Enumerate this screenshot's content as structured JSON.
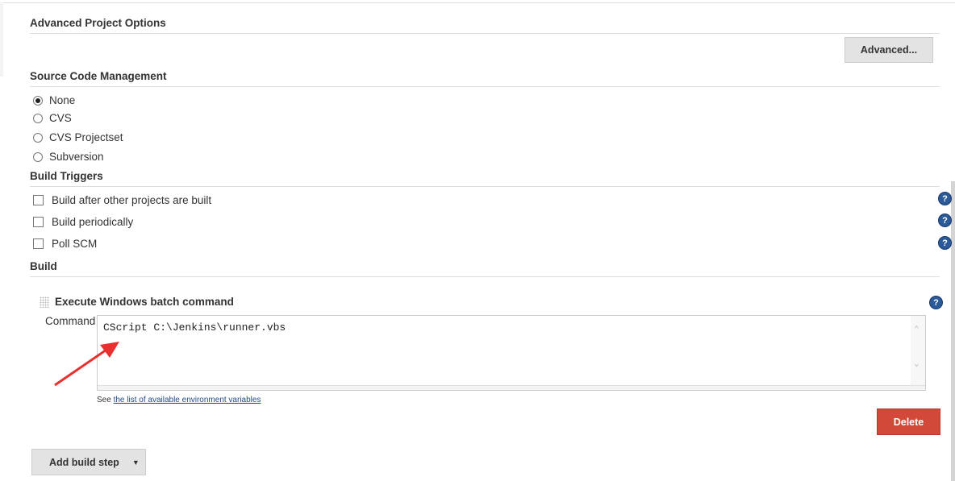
{
  "advanced_section": {
    "title": "Advanced Project Options",
    "button": "Advanced..."
  },
  "scm": {
    "title": "Source Code Management",
    "options": [
      {
        "label": "None",
        "selected": true
      },
      {
        "label": "CVS",
        "selected": false
      },
      {
        "label": "CVS Projectset",
        "selected": false
      },
      {
        "label": "Subversion",
        "selected": false
      }
    ]
  },
  "triggers": {
    "title": "Build Triggers",
    "options": [
      {
        "label": "Build after other projects are built",
        "checked": false
      },
      {
        "label": "Build periodically",
        "checked": false
      },
      {
        "label": "Poll SCM",
        "checked": false
      }
    ]
  },
  "build": {
    "title": "Build",
    "step_title": "Execute Windows batch command",
    "command_label": "Command",
    "command_value": "CScript C:\\Jenkins\\runner.vbs",
    "see_text": "See",
    "env_link": "the list of available environment variables",
    "delete_button": "Delete",
    "add_step_button": "Add build step"
  },
  "colors": {
    "delete": "#d24939",
    "help": "#2a5a9a",
    "arrow": "#e8312f"
  }
}
